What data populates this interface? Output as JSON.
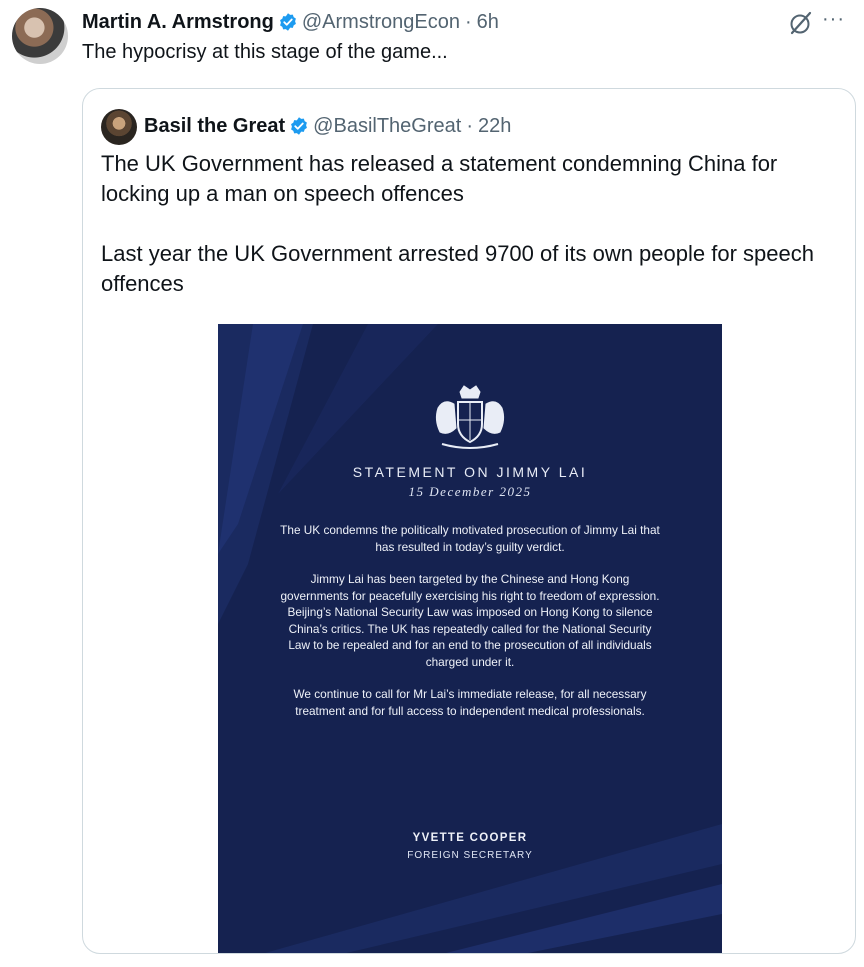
{
  "post": {
    "author_name": "Martin A. Armstrong",
    "author_handle": "@ArmstrongEcon",
    "separator": "·",
    "time": "6h",
    "text": "The hypocrisy at this stage of the game...",
    "more_label": "···"
  },
  "quote": {
    "author_name": "Basil the Great",
    "author_handle": "@BasilTheGreat",
    "separator": "·",
    "time": "22h",
    "paragraphs": [
      "The UK Government has released a statement condemning China for locking up a man on speech offences",
      "Last year the UK Government arrested 9700 of its own people for speech offences"
    ]
  },
  "statement": {
    "title": "STATEMENT ON JIMMY LAI",
    "date": "15 December 2025",
    "paragraphs": [
      "The UK condemns the politically motivated prosecution of Jimmy Lai that has resulted in today’s guilty verdict.",
      "Jimmy Lai has been targeted by the Chinese and Hong Kong governments for peacefully exercising his right to freedom of expression. Beijing’s National Security Law was imposed on Hong Kong to silence China’s critics. The UK has repeatedly called for the National Security Law to be repealed and for an end to the prosecution of all individuals charged under it.",
      "We continue to call for Mr Lai’s immediate release, for all necessary treatment and for full access to independent medical professionals."
    ],
    "signatory": "YVETTE COOPER",
    "role": "FOREIGN SECRETARY"
  },
  "colors": {
    "verified_blue": "#1d9bf0",
    "muted_text": "#536471",
    "statement_navy": "#152250"
  },
  "icons": [
    "verified-badge-icon",
    "grok-icon",
    "more-icon",
    "royal-crest-icon"
  ]
}
